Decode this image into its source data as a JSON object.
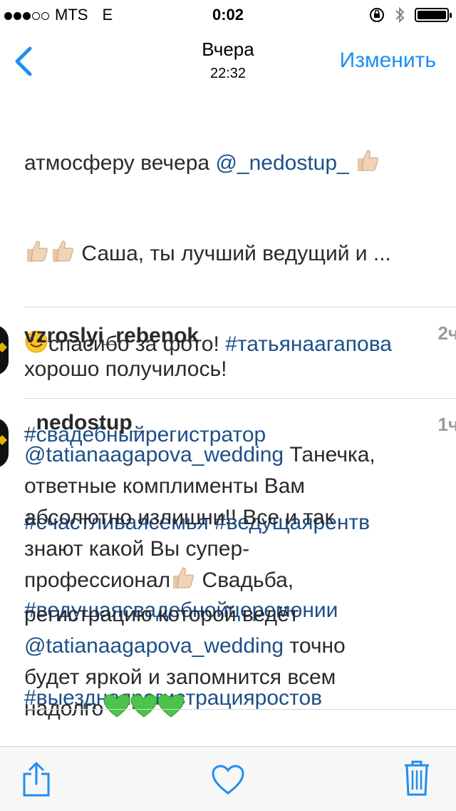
{
  "status_bar": {
    "carrier": "MTS",
    "network": "E",
    "time": "0:02",
    "signal_filled": 3,
    "signal_total": 5,
    "battery_level": 1.0
  },
  "nav": {
    "title": "Вчера",
    "subtitle": "22:32",
    "edit_label": "Изменить"
  },
  "caption": {
    "line1_text": "атмосферу вечера ",
    "line1_mention": "@_nedostup_",
    "line2_text": " Саша, ты лучший ведущий и ...",
    "line3_text": "спасибо за фото! ",
    "line3_tag": "#татьянаагапова",
    "tags": [
      "#свадебныйрегистратор",
      "#счастливаясемья #ведущаярентв",
      "#ведушаясвадебнойцеремонии",
      "#выезднаярегистрацияростов"
    ]
  },
  "comments": [
    {
      "username": "vzroslyi_rebenok",
      "time": "2ч",
      "text": "хорошо получилось!"
    },
    {
      "username": "_nedostup_",
      "time": "1ч",
      "mention1": "@tatianaagapova_wedding",
      "part1": " Танечка,\nответные комплименты Вам\nабсолютно излишни!! Все и так\nзнают какой Вы супер-\nпрофессионал",
      "part2": " Свадьба,\nрегистрацию которой ведёт\n",
      "mention2": "@tatianaagapova_wedding",
      "part3": " точно\nбудет яркой и запомнится всем\nнадолго"
    }
  ],
  "colors": {
    "accent": "#1f8ef1",
    "link": "#1d4f8a",
    "heart_green": "#4cc34a"
  },
  "icons": {
    "back": "chevron-left-icon",
    "share": "share-icon",
    "like": "heart-icon",
    "delete": "trash-icon"
  }
}
